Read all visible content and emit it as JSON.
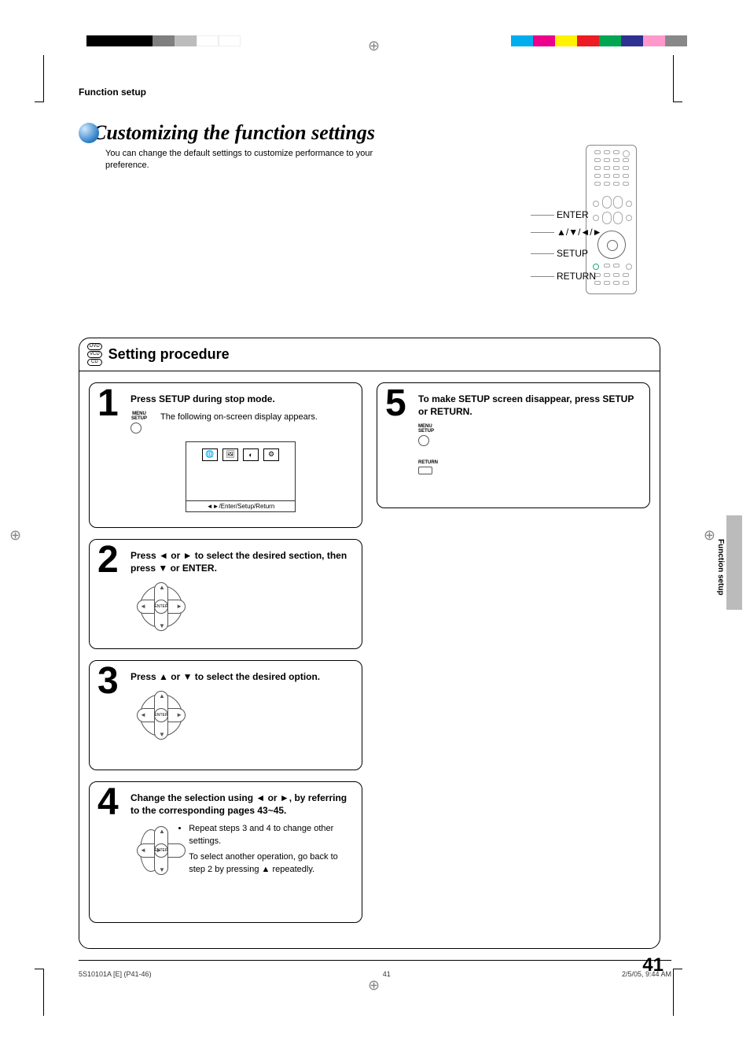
{
  "header": {
    "section_label": "Function setup",
    "main_title": "Customizing the function settings",
    "subtitle": "You can change the default settings to customize performance to your preference."
  },
  "remote": {
    "labels": {
      "enter": "ENTER",
      "arrows": "▲/▼/◄/►",
      "setup": "SETUP",
      "return": "RETURN"
    }
  },
  "procedure": {
    "discs": {
      "dvd": "DVD",
      "vcd": "VCD",
      "cd": "CD"
    },
    "title": "Setting procedure",
    "steps": [
      {
        "num": "1",
        "title": "Press SETUP during stop mode.",
        "button_label": "MENU\nSETUP",
        "note": "The following on-screen display appears.",
        "osd_footer": "◄►/Enter/Setup/Return"
      },
      {
        "num": "2",
        "title": "Press ◄ or ► to select the desired section, then press ▼ or ENTER.",
        "dpad_center": "ENTER"
      },
      {
        "num": "3",
        "title": "Press ▲ or ▼ to select the desired option.",
        "dpad_center": "ENTER"
      },
      {
        "num": "4",
        "title": "Change the selection using ◄ or ►, by referring to the corresponding pages 43~45.",
        "dpad_center": "ENTER",
        "bullets": [
          "Repeat steps 3 and 4 to change other settings.",
          "To select another operation, go back to step 2 by pressing ▲ repeatedly."
        ]
      },
      {
        "num": "5",
        "title": "To make SETUP screen disappear, press SETUP or RETURN.",
        "button_label": "MENU\nSETUP",
        "return_label": "RETURN"
      }
    ]
  },
  "side_tab": "Function setup",
  "page_number": "41",
  "footer": {
    "left": "5S10101A [E] (P41-46)",
    "center": "41",
    "right": "2/5/05, 9:44 AM"
  }
}
